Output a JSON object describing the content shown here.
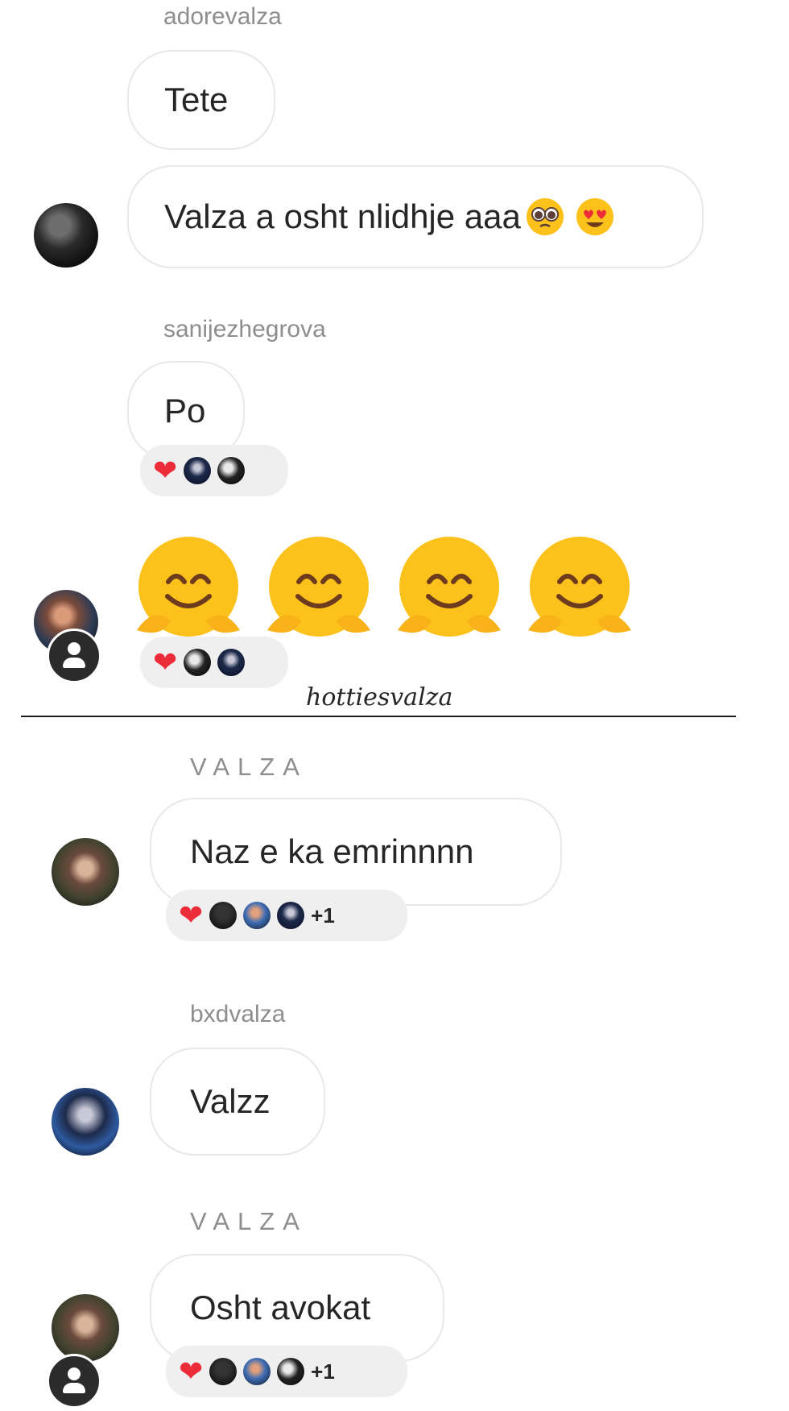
{
  "top_screenshot": {
    "messages": [
      {
        "username": "adorevalza",
        "bubbles": [
          "Tete",
          "Valza a osht nlidhje aaa"
        ]
      },
      {
        "username": "sanijezhegrova",
        "bubbles": [
          "Po"
        ]
      }
    ],
    "emoji_message": {
      "emoji": [
        "hugging-face",
        "hugging-face",
        "hugging-face",
        "hugging-face"
      ]
    },
    "watermark": "hottiesvalza"
  },
  "bottom_screenshot": {
    "messages": [
      {
        "username": "VALZA",
        "text": "Naz e ka emrinnnn",
        "reaction_extra": "+1"
      },
      {
        "username": "bxdvalza",
        "text": "Valzz"
      },
      {
        "username": "VALZA",
        "text": "Osht avokat",
        "reaction_extra": "+1"
      }
    ]
  },
  "colors": {
    "heart": "#ed2c39",
    "bubble_border": "#e8e8e8",
    "username": "#8e8e8e",
    "reaction_bg": "#efefef"
  }
}
